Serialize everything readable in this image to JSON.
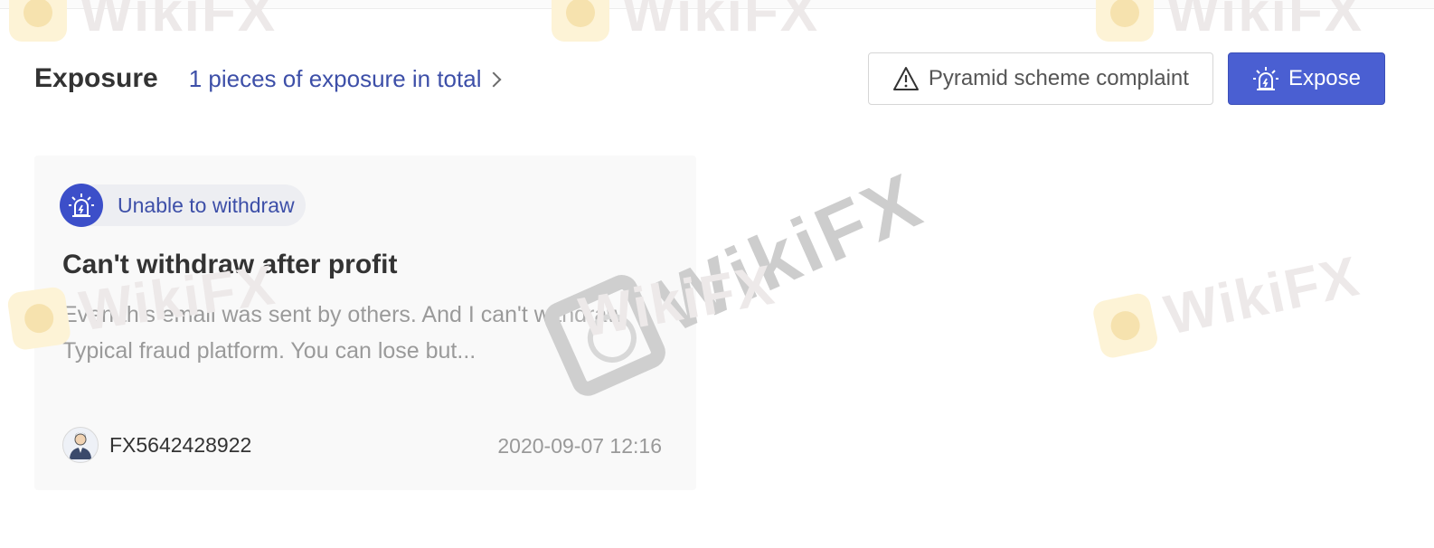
{
  "header": {
    "title": "Exposure",
    "total_link": "1 pieces of exposure in total"
  },
  "actions": {
    "complaint_label": "Pyramid scheme complaint",
    "expose_label": "Expose"
  },
  "card": {
    "tag_label": "Unable to withdraw",
    "title": "Can't withdraw after profit",
    "body": "Even this email was sent by others. And I can't withdraw. Typical fraud platform. You can lose but...",
    "author": "FX5642428922",
    "date": "2020-09-07 12:16"
  },
  "watermark": {
    "text": "WikiFX"
  },
  "icons": {
    "complaint": "warning-triangle-icon",
    "expose": "alarm-light-icon",
    "tag": "alarm-light-icon",
    "chevron": "chevron-right-icon",
    "avatar": "user-avatar-icon"
  },
  "colors": {
    "accent": "#4a5fd2",
    "link": "#3d4fa8",
    "title": "#333333",
    "muted": "#9a9a9a"
  }
}
